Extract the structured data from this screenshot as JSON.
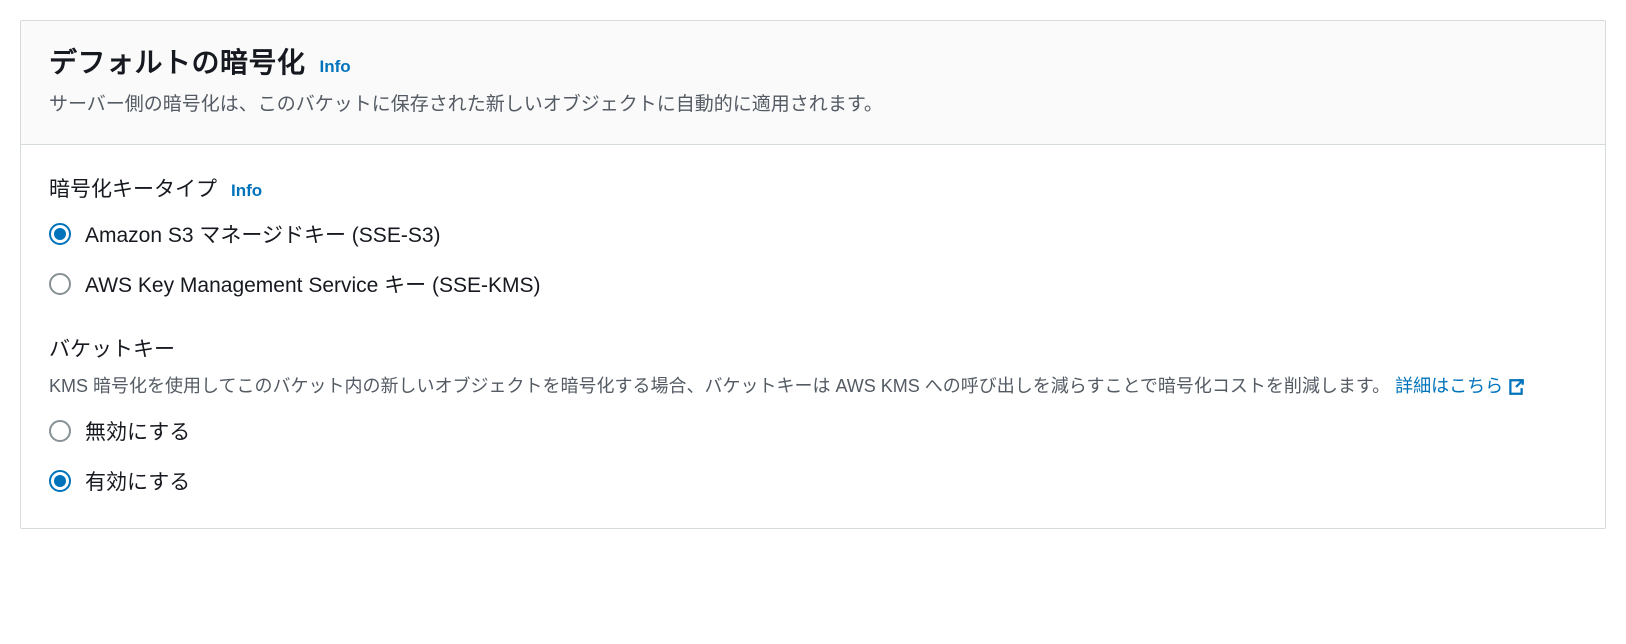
{
  "header": {
    "title": "デフォルトの暗号化",
    "info_link": "Info",
    "description": "サーバー側の暗号化は、このバケットに保存された新しいオブジェクトに自動的に適用されます。"
  },
  "encryption_key_type": {
    "title": "暗号化キータイプ",
    "info_link": "Info",
    "options": [
      {
        "label": "Amazon S3 マネージドキー (SSE-S3)",
        "selected": true
      },
      {
        "label": "AWS Key Management Service キー (SSE-KMS)",
        "selected": false
      }
    ]
  },
  "bucket_key": {
    "title": "バケットキー",
    "description": "KMS 暗号化を使用してこのバケット内の新しいオブジェクトを暗号化する場合、バケットキーは AWS KMS への呼び出しを減らすことで暗号化コストを削減します。",
    "learn_more": "詳細はこちら",
    "options": [
      {
        "label": "無効にする",
        "selected": false
      },
      {
        "label": "有効にする",
        "selected": true
      }
    ]
  }
}
